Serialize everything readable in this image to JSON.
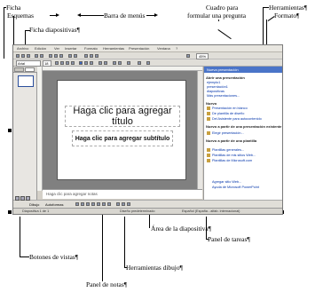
{
  "callouts": {
    "ficha": "Ficha",
    "esquemas": "Esquemas",
    "ficha_diapositivas": "Ficha diapositivas¶",
    "barra_de_menus": "Barra de menús",
    "cuadro_para_formular_line1": "Cuadro para",
    "cuadro_para_formular_line2": "formular una pregunta",
    "herramientas": "Herramientas¶",
    "formato": "Formato¶",
    "area_de_la_diapositiva": "Área de la diapositiva¶",
    "panel_de_tareas": "Panel de tareas¶",
    "botones_de_vistas": "Botones de vistas¶",
    "herramientas_dibujo": "Herramientas dibujo¶",
    "panel_de_notas": "Panel de notas¶"
  },
  "app": {
    "menu_items": [
      "Archivo",
      "Edición",
      "Ver",
      "Insertar",
      "Formato",
      "Herramientas",
      "Presentación",
      "Ventana",
      "?"
    ],
    "font_name": "Arial",
    "font_size": "18",
    "zoom": "45%"
  },
  "slide": {
    "title_placeholder": "Haga clic para agregar título",
    "subtitle_placeholder": "Haga clic para agregar subtítulo"
  },
  "notes": {
    "placeholder": "Haga clic para agregar notas"
  },
  "task_pane": {
    "title": "Nueva presentación",
    "sections": [
      {
        "heading": "Abrir una presentación",
        "items": [
          "ejemplo1",
          "presentación1",
          "diapositivas",
          "Más presentaciones..."
        ]
      },
      {
        "heading": "Nuevo",
        "items": [
          "Presentación en blanco",
          "De plantilla de diseño",
          "Del Asistente para autocontenido"
        ]
      },
      {
        "heading": "Nuevo a partir de una presentación existente",
        "items": [
          "Elegir presentación..."
        ]
      },
      {
        "heading": "Nuevo a partir de una plantilla",
        "items": [
          "Plantillas generales...",
          "Plantillas de mis sitios Web...",
          "Plantillas de Microsoft.com"
        ]
      }
    ],
    "footer": [
      "Agregar sitio Web...",
      "Ayuda de Microsoft PowerPoint"
    ]
  },
  "status": {
    "slide": "Diapositiva 1 de 1",
    "design": "Diseño predeterminado",
    "language": "Español (España - alfab. internacional)"
  },
  "drawbar": {
    "label": "Dibujo",
    "autoshapes": "Autoformas"
  }
}
